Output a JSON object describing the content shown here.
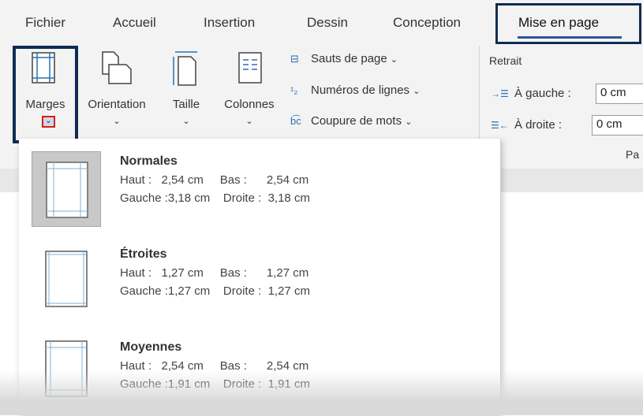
{
  "tabs": [
    "Fichier",
    "Accueil",
    "Insertion",
    "Dessin",
    "Conception",
    "Mise en page"
  ],
  "ribbon": {
    "big_buttons": [
      "Marges",
      "Orientation",
      "Taille",
      "Colonnes"
    ],
    "chevron": "⌄",
    "small_buttons": [
      "Sauts de page",
      "Numéros de lignes",
      "Coupure de mots"
    ],
    "indent": {
      "title": "Retrait",
      "left_label": "À gauche :",
      "left_value": "0 cm",
      "right_label": "À droite :",
      "right_value": "0 cm"
    },
    "group_label": "Pa"
  },
  "margins_menu": [
    {
      "name": "Normales",
      "line1": "Haut :   2,54 cm     Bas :      2,54 cm",
      "line2": "Gauche :3,18 cm    Droite :  3,18 cm",
      "selected": true
    },
    {
      "name": "Étroites",
      "line1": "Haut :   1,27 cm     Bas :      1,27 cm",
      "line2": "Gauche :1,27 cm    Droite :  1,27 cm",
      "selected": false
    },
    {
      "name": "Moyennes",
      "line1": "Haut :   2,54 cm     Bas :      2,54 cm",
      "line2": "Gauche :1,91 cm    Droite :  1,91 cm",
      "selected": false
    }
  ],
  "colors": {
    "accent": "#2b579a",
    "highlight_box": "#0f2d52",
    "red_box": "#d0201b",
    "ribbon_bg": "#f3f3f3"
  }
}
